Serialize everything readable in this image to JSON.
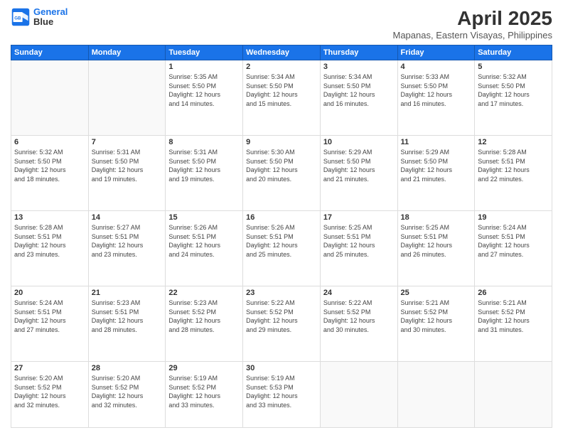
{
  "header": {
    "logo_line1": "General",
    "logo_line2": "Blue",
    "title": "April 2025",
    "subtitle": "Mapanas, Eastern Visayas, Philippines"
  },
  "columns": [
    "Sunday",
    "Monday",
    "Tuesday",
    "Wednesday",
    "Thursday",
    "Friday",
    "Saturday"
  ],
  "weeks": [
    [
      {
        "day": "",
        "info": ""
      },
      {
        "day": "",
        "info": ""
      },
      {
        "day": "1",
        "info": "Sunrise: 5:35 AM\nSunset: 5:50 PM\nDaylight: 12 hours\nand 14 minutes."
      },
      {
        "day": "2",
        "info": "Sunrise: 5:34 AM\nSunset: 5:50 PM\nDaylight: 12 hours\nand 15 minutes."
      },
      {
        "day": "3",
        "info": "Sunrise: 5:34 AM\nSunset: 5:50 PM\nDaylight: 12 hours\nand 16 minutes."
      },
      {
        "day": "4",
        "info": "Sunrise: 5:33 AM\nSunset: 5:50 PM\nDaylight: 12 hours\nand 16 minutes."
      },
      {
        "day": "5",
        "info": "Sunrise: 5:32 AM\nSunset: 5:50 PM\nDaylight: 12 hours\nand 17 minutes."
      }
    ],
    [
      {
        "day": "6",
        "info": "Sunrise: 5:32 AM\nSunset: 5:50 PM\nDaylight: 12 hours\nand 18 minutes."
      },
      {
        "day": "7",
        "info": "Sunrise: 5:31 AM\nSunset: 5:50 PM\nDaylight: 12 hours\nand 19 minutes."
      },
      {
        "day": "8",
        "info": "Sunrise: 5:31 AM\nSunset: 5:50 PM\nDaylight: 12 hours\nand 19 minutes."
      },
      {
        "day": "9",
        "info": "Sunrise: 5:30 AM\nSunset: 5:50 PM\nDaylight: 12 hours\nand 20 minutes."
      },
      {
        "day": "10",
        "info": "Sunrise: 5:29 AM\nSunset: 5:50 PM\nDaylight: 12 hours\nand 21 minutes."
      },
      {
        "day": "11",
        "info": "Sunrise: 5:29 AM\nSunset: 5:50 PM\nDaylight: 12 hours\nand 21 minutes."
      },
      {
        "day": "12",
        "info": "Sunrise: 5:28 AM\nSunset: 5:51 PM\nDaylight: 12 hours\nand 22 minutes."
      }
    ],
    [
      {
        "day": "13",
        "info": "Sunrise: 5:28 AM\nSunset: 5:51 PM\nDaylight: 12 hours\nand 23 minutes."
      },
      {
        "day": "14",
        "info": "Sunrise: 5:27 AM\nSunset: 5:51 PM\nDaylight: 12 hours\nand 23 minutes."
      },
      {
        "day": "15",
        "info": "Sunrise: 5:26 AM\nSunset: 5:51 PM\nDaylight: 12 hours\nand 24 minutes."
      },
      {
        "day": "16",
        "info": "Sunrise: 5:26 AM\nSunset: 5:51 PM\nDaylight: 12 hours\nand 25 minutes."
      },
      {
        "day": "17",
        "info": "Sunrise: 5:25 AM\nSunset: 5:51 PM\nDaylight: 12 hours\nand 25 minutes."
      },
      {
        "day": "18",
        "info": "Sunrise: 5:25 AM\nSunset: 5:51 PM\nDaylight: 12 hours\nand 26 minutes."
      },
      {
        "day": "19",
        "info": "Sunrise: 5:24 AM\nSunset: 5:51 PM\nDaylight: 12 hours\nand 27 minutes."
      }
    ],
    [
      {
        "day": "20",
        "info": "Sunrise: 5:24 AM\nSunset: 5:51 PM\nDaylight: 12 hours\nand 27 minutes."
      },
      {
        "day": "21",
        "info": "Sunrise: 5:23 AM\nSunset: 5:51 PM\nDaylight: 12 hours\nand 28 minutes."
      },
      {
        "day": "22",
        "info": "Sunrise: 5:23 AM\nSunset: 5:52 PM\nDaylight: 12 hours\nand 28 minutes."
      },
      {
        "day": "23",
        "info": "Sunrise: 5:22 AM\nSunset: 5:52 PM\nDaylight: 12 hours\nand 29 minutes."
      },
      {
        "day": "24",
        "info": "Sunrise: 5:22 AM\nSunset: 5:52 PM\nDaylight: 12 hours\nand 30 minutes."
      },
      {
        "day": "25",
        "info": "Sunrise: 5:21 AM\nSunset: 5:52 PM\nDaylight: 12 hours\nand 30 minutes."
      },
      {
        "day": "26",
        "info": "Sunrise: 5:21 AM\nSunset: 5:52 PM\nDaylight: 12 hours\nand 31 minutes."
      }
    ],
    [
      {
        "day": "27",
        "info": "Sunrise: 5:20 AM\nSunset: 5:52 PM\nDaylight: 12 hours\nand 32 minutes."
      },
      {
        "day": "28",
        "info": "Sunrise: 5:20 AM\nSunset: 5:52 PM\nDaylight: 12 hours\nand 32 minutes."
      },
      {
        "day": "29",
        "info": "Sunrise: 5:19 AM\nSunset: 5:52 PM\nDaylight: 12 hours\nand 33 minutes."
      },
      {
        "day": "30",
        "info": "Sunrise: 5:19 AM\nSunset: 5:53 PM\nDaylight: 12 hours\nand 33 minutes."
      },
      {
        "day": "",
        "info": ""
      },
      {
        "day": "",
        "info": ""
      },
      {
        "day": "",
        "info": ""
      }
    ]
  ]
}
